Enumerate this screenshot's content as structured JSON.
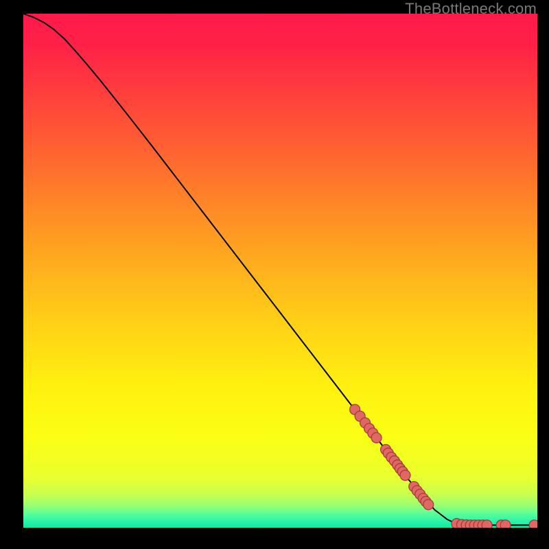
{
  "watermark": "TheBottleneck.com",
  "chart_data": {
    "type": "line",
    "title": "",
    "xlabel": "",
    "ylabel": "",
    "xlim": [
      0,
      100
    ],
    "ylim": [
      0,
      100
    ],
    "background_gradient_stops": [
      {
        "offset": 0.0,
        "color": "#ff1a4b"
      },
      {
        "offset": 0.06,
        "color": "#ff2147"
      },
      {
        "offset": 0.14,
        "color": "#ff3a3f"
      },
      {
        "offset": 0.24,
        "color": "#ff5a34"
      },
      {
        "offset": 0.36,
        "color": "#ff8328"
      },
      {
        "offset": 0.48,
        "color": "#ffab1e"
      },
      {
        "offset": 0.6,
        "color": "#ffd016"
      },
      {
        "offset": 0.72,
        "color": "#ffef10"
      },
      {
        "offset": 0.82,
        "color": "#fbff14"
      },
      {
        "offset": 0.9,
        "color": "#eaff2e"
      },
      {
        "offset": 0.935,
        "color": "#c9ff4e"
      },
      {
        "offset": 0.955,
        "color": "#9dff6f"
      },
      {
        "offset": 0.97,
        "color": "#66ff94"
      },
      {
        "offset": 0.985,
        "color": "#30f7a8"
      },
      {
        "offset": 1.0,
        "color": "#14e6a3"
      }
    ],
    "curve": [
      {
        "x": 0.0,
        "y": 100.0
      },
      {
        "x": 2.0,
        "y": 99.3
      },
      {
        "x": 4.0,
        "y": 98.3
      },
      {
        "x": 6.0,
        "y": 96.9
      },
      {
        "x": 8.0,
        "y": 95.1
      },
      {
        "x": 10.0,
        "y": 92.9
      },
      {
        "x": 12.5,
        "y": 90.0
      },
      {
        "x": 15.0,
        "y": 87.0
      },
      {
        "x": 20.0,
        "y": 80.7
      },
      {
        "x": 25.0,
        "y": 74.3
      },
      {
        "x": 30.0,
        "y": 67.8
      },
      {
        "x": 35.0,
        "y": 61.3
      },
      {
        "x": 40.0,
        "y": 54.8
      },
      {
        "x": 45.0,
        "y": 48.3
      },
      {
        "x": 50.0,
        "y": 41.8
      },
      {
        "x": 55.0,
        "y": 35.3
      },
      {
        "x": 60.0,
        "y": 28.8
      },
      {
        "x": 65.0,
        "y": 22.3
      },
      {
        "x": 70.0,
        "y": 15.8
      },
      {
        "x": 75.0,
        "y": 9.3
      },
      {
        "x": 80.0,
        "y": 3.5
      },
      {
        "x": 82.5,
        "y": 1.6
      },
      {
        "x": 84.0,
        "y": 0.9
      },
      {
        "x": 85.0,
        "y": 0.6
      },
      {
        "x": 87.0,
        "y": 0.5
      },
      {
        "x": 90.0,
        "y": 0.5
      },
      {
        "x": 95.0,
        "y": 0.5
      },
      {
        "x": 100.0,
        "y": 0.5
      }
    ],
    "markers": [
      {
        "x": 64.5,
        "y": 23.0
      },
      {
        "x": 65.5,
        "y": 21.7
      },
      {
        "x": 66.5,
        "y": 20.4
      },
      {
        "x": 67.3,
        "y": 19.3
      },
      {
        "x": 68.0,
        "y": 18.4
      },
      {
        "x": 68.7,
        "y": 17.5
      },
      {
        "x": 70.5,
        "y": 15.2
      },
      {
        "x": 71.0,
        "y": 14.5
      },
      {
        "x": 71.6,
        "y": 13.7
      },
      {
        "x": 72.2,
        "y": 13.0
      },
      {
        "x": 72.8,
        "y": 12.2
      },
      {
        "x": 73.3,
        "y": 11.5
      },
      {
        "x": 73.8,
        "y": 10.9
      },
      {
        "x": 74.3,
        "y": 10.2
      },
      {
        "x": 76.0,
        "y": 8.0
      },
      {
        "x": 76.6,
        "y": 7.2
      },
      {
        "x": 77.2,
        "y": 6.5
      },
      {
        "x": 77.8,
        "y": 5.7
      },
      {
        "x": 78.3,
        "y": 5.1
      },
      {
        "x": 78.8,
        "y": 4.5
      },
      {
        "x": 84.3,
        "y": 0.8
      },
      {
        "x": 85.3,
        "y": 0.6
      },
      {
        "x": 86.2,
        "y": 0.55
      },
      {
        "x": 87.0,
        "y": 0.5
      },
      {
        "x": 87.8,
        "y": 0.5
      },
      {
        "x": 88.6,
        "y": 0.5
      },
      {
        "x": 89.4,
        "y": 0.5
      },
      {
        "x": 90.2,
        "y": 0.5
      },
      {
        "x": 93.0,
        "y": 0.5
      },
      {
        "x": 93.8,
        "y": 0.5
      },
      {
        "x": 99.4,
        "y": 0.5
      }
    ],
    "marker_style": {
      "radius_px": 7.5,
      "fill": "#e06763",
      "stroke": "#9c3a36",
      "stroke_width": 1.2
    },
    "curve_style": {
      "stroke": "#000000",
      "stroke_width": 2.0
    }
  }
}
